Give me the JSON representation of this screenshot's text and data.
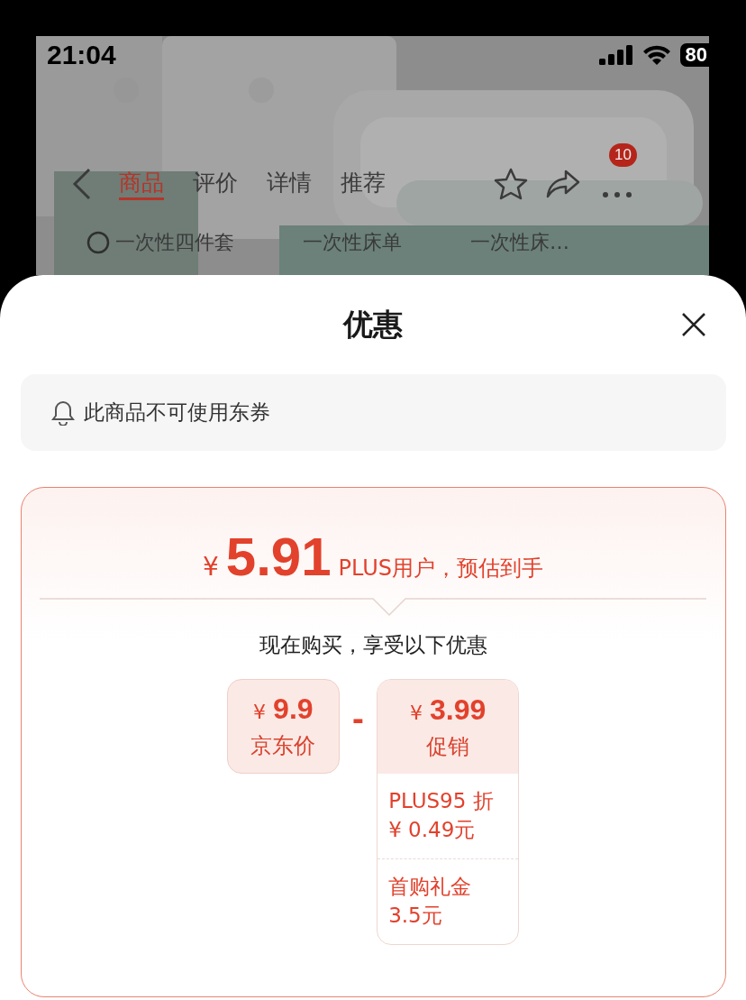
{
  "status_bar": {
    "time": "21:04",
    "battery": "80"
  },
  "nav": {
    "tabs": [
      {
        "label": "商品",
        "selected": true
      },
      {
        "label": "评价",
        "selected": false
      },
      {
        "label": "详情",
        "selected": false
      },
      {
        "label": "推荐",
        "selected": false
      }
    ],
    "badge": "10"
  },
  "sub_tabs": [
    {
      "label": "一次性四件套"
    },
    {
      "label": "一次性床单"
    },
    {
      "label": "一次性床…"
    }
  ],
  "sheet": {
    "title": "优惠",
    "notice": "此商品不可使用东券",
    "estimate": {
      "currency": "¥",
      "price": "5.91",
      "note": "PLUS用户，预估到手"
    },
    "subtitle": "现在购买，享受以下优惠",
    "jd_price": {
      "currency": "¥",
      "amount": "9.9",
      "label": "京东价"
    },
    "operator": "-",
    "promotion": {
      "currency": "¥",
      "amount": "3.99",
      "label": "促销",
      "items": [
        {
          "name": "PLUS95 折",
          "value": "¥ 0.49元"
        },
        {
          "name": "首购礼金",
          "value": "3.5元"
        }
      ]
    }
  }
}
